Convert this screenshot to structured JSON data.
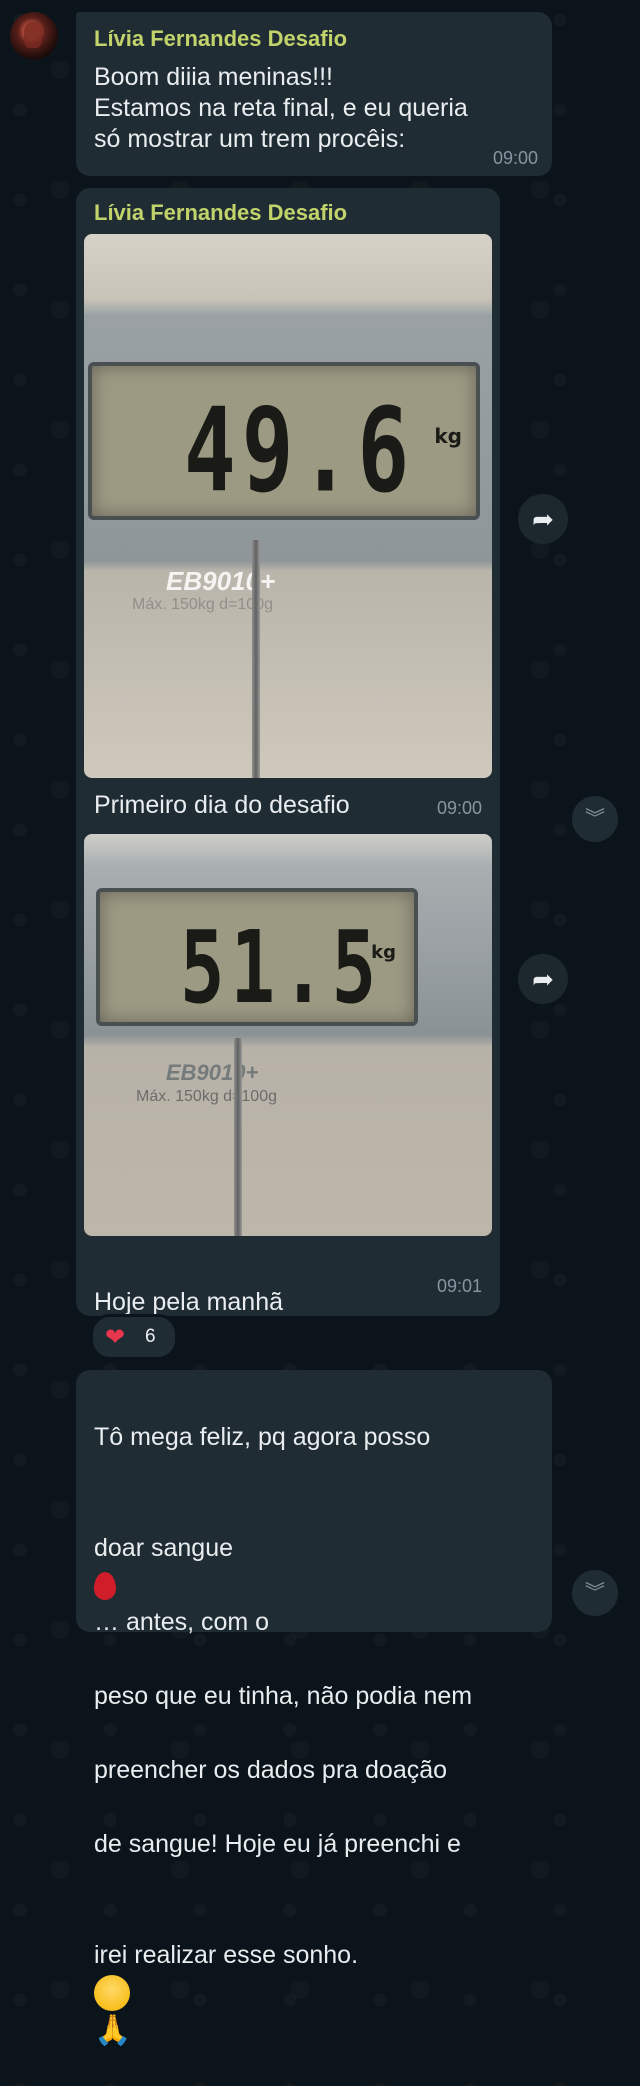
{
  "messages": [
    {
      "sender": "Lívia Fernandes Desafio",
      "text": "Boom diiia meninas!!!\nEstamos na reta final, e eu queria\nsó mostrar um trem procêis:",
      "time": "09:00"
    },
    {
      "sender": "Lívia Fernandes Desafio",
      "photos": [
        {
          "reading": "49.6",
          "unit": "kg",
          "model": "EB9010+",
          "spec": "Máx. 150kg  d=100g",
          "caption": "Primeiro dia do desafio",
          "time": "09:00"
        },
        {
          "reading": "51.5",
          "unit": "kg",
          "model": "EB9010+",
          "spec": "Máx. 150kg d=100g",
          "caption": "Hoje pela manhã",
          "time": "09:01"
        }
      ],
      "reaction": {
        "icon": "heart",
        "count": "6"
      }
    },
    {
      "text_parts": {
        "l1": "Tô mega feliz, pq agora posso",
        "l2a": "doar sangue",
        "l2b": "… antes, com o",
        "l3": "peso que eu tinha, não podia nem",
        "l4": "preencher os dados pra doação",
        "l5": "de sangue! Hoje eu já preenchi e",
        "l6": "irei realizar esse sonho."
      }
    }
  ],
  "icons": {
    "forward": "forward-arrow-icon",
    "scroll_down": "chevron-double-down-icon"
  },
  "colors": {
    "background": "#0b141a",
    "bubble": "#202c33",
    "sender": "#c1d36a",
    "text": "#e9edef",
    "time": "#8696a0"
  }
}
